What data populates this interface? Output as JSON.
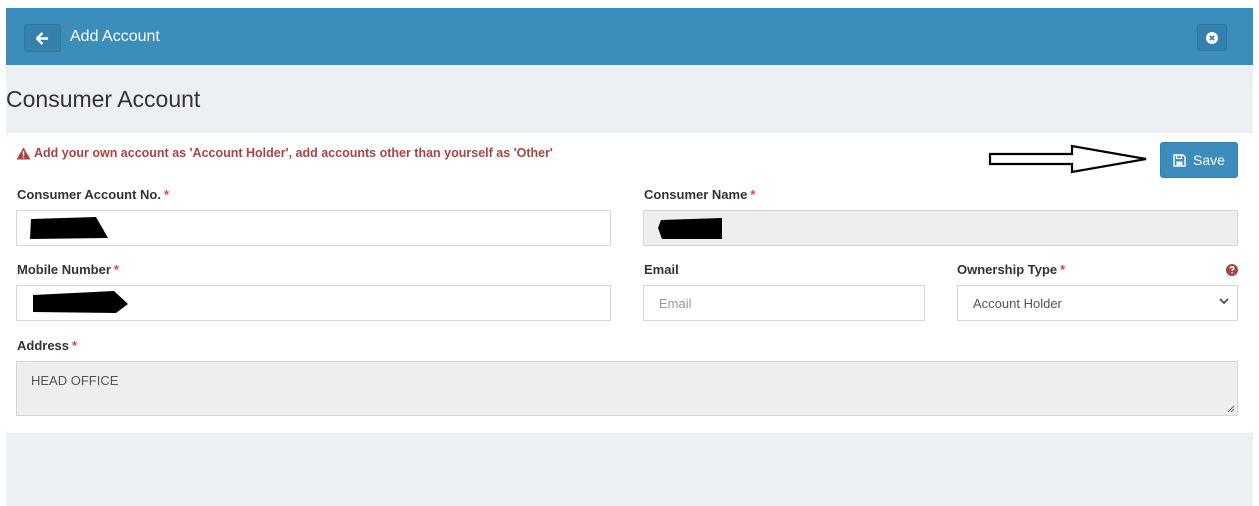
{
  "header": {
    "title": "Add Account",
    "back_icon": "arrow-left-icon",
    "close_icon": "times-circle-icon",
    "color": "#3c8dbc"
  },
  "page": {
    "title": "Consumer Account"
  },
  "form": {
    "warning": "Add your own account as 'Account Holder', add accounts other than yourself as 'Other'",
    "warning_icon": "warning-triangle-icon",
    "save_label": "Save",
    "save_icon": "floppy-disk-icon",
    "required_mark": "*",
    "fields": {
      "consumer_account_no": {
        "label": "Consumer Account No.",
        "value": ""
      },
      "consumer_name": {
        "label": "Consumer Name",
        "value": ""
      },
      "mobile_number": {
        "label": "Mobile Number",
        "value": ""
      },
      "email": {
        "label": "Email",
        "value": "",
        "placeholder": "Email"
      },
      "ownership_type": {
        "label": "Ownership Type",
        "value": "Account Holder",
        "help_icon": "question-circle-icon"
      },
      "address": {
        "label": "Address",
        "value": "HEAD OFFICE"
      }
    }
  },
  "colors": {
    "warning": "#a94442",
    "required": "#dd4b39",
    "primary": "#3c8dbc"
  }
}
